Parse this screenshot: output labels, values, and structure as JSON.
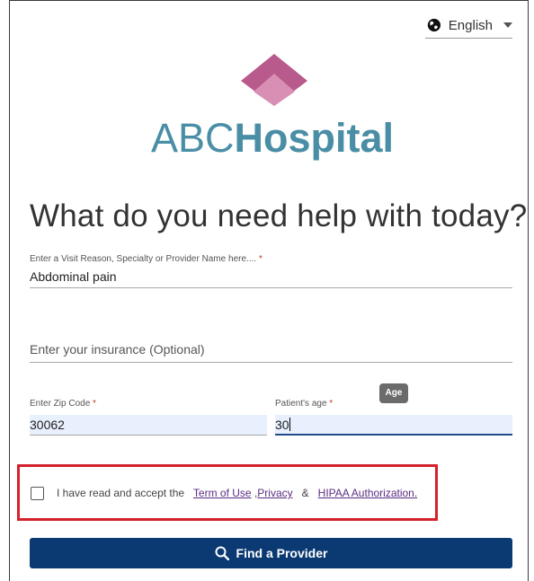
{
  "language": {
    "label": "English",
    "icon": "globe-icon"
  },
  "brand": {
    "part1": "ABC",
    "part2": "Hospital",
    "color": "#4a8ea6",
    "logo_colors": [
      "#b85a8c",
      "#d98fb4"
    ]
  },
  "headline": "What do you need help with today?",
  "form": {
    "visit": {
      "label": "Enter a Visit Reason, Specialty or Provider Name here....",
      "required": "*",
      "value": "Abdominal pain"
    },
    "insurance": {
      "placeholder": "Enter your insurance (Optional)"
    },
    "zip": {
      "label": "Enter Zip Code",
      "required": "*",
      "value": "30062"
    },
    "age": {
      "label": "Patient's age",
      "required": "*",
      "value": "30",
      "tooltip": "Age"
    }
  },
  "consent": {
    "prefix": "I have read and accept the",
    "terms_link": "Term of Use",
    "comma": ",",
    "privacy_link": "Privacy",
    "amp": "&",
    "hipaa_link": "HIPAA Authorization."
  },
  "cta": {
    "label": "Find a Provider",
    "icon": "search-icon",
    "color": "#0b3a73"
  },
  "accents": {
    "highlight_border": "#d4212b",
    "link": "#5a2d82"
  }
}
